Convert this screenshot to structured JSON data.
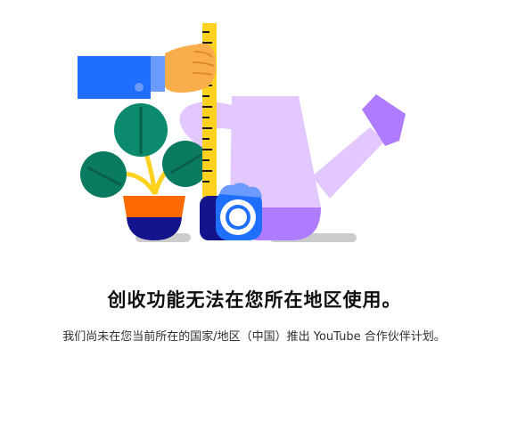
{
  "message": {
    "title": "创收功能无法在您所在地区使用。",
    "description": "我们尚未在您当前所在的国家/地区（中国）推出 YouTube 合作伙伴计划。"
  },
  "illustration": {
    "label": "",
    "colors": {
      "sleeve": "#1f6fff",
      "cuff": "#6b9bff",
      "hand": "#f9ad4b",
      "ruler": "#ffd21f",
      "leaf": "#0c8a6d",
      "leaf_dark": "#0a7a60",
      "pot": "#ff6a00",
      "pot_base": "#13148c",
      "can": "#e3c8ff",
      "can_dark": "#b07cff",
      "shadow": "#cccccc",
      "tape": "#1f6fff",
      "tape_base": "#13148c"
    }
  }
}
